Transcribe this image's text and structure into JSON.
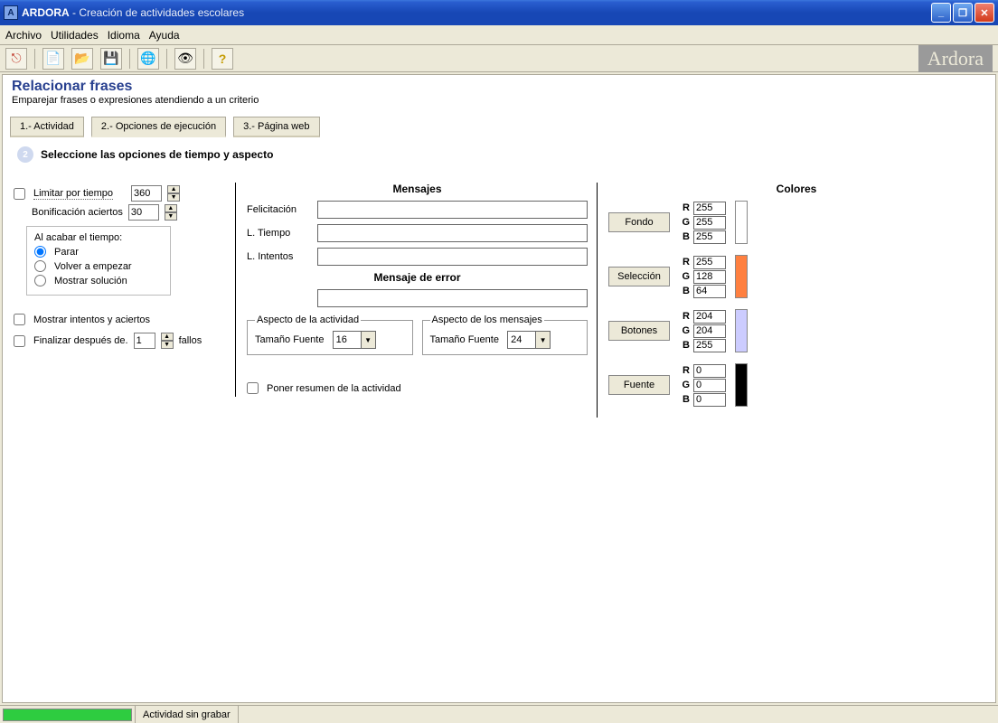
{
  "window": {
    "appname": "ARDORA",
    "subtitle": "Creación de actividades escolares"
  },
  "menus": [
    "Archivo",
    "Utilidades",
    "Idioma",
    "Ayuda"
  ],
  "brand": "Ardora",
  "header": {
    "title": "Relacionar frases",
    "desc": "Emparejar frases o expresiones atendiendo a un criterio"
  },
  "tabs": [
    {
      "label": "1.- Actividad"
    },
    {
      "label": "2.- Opciones de ejecución"
    },
    {
      "label": "3.- Página web"
    }
  ],
  "section_num": "2",
  "section_title": "Seleccione las opciones de tiempo y aspecto",
  "left": {
    "limit_time_label": "Limitar por tiempo",
    "limit_time_value": "360",
    "bonus_label": "Bonificación aciertos",
    "bonus_value": "30",
    "on_end_label": "Al acabar el tiempo:",
    "on_end_options": [
      "Parar",
      "Volver a empezar",
      "Mostrar solución"
    ],
    "show_attempts_label": "Mostrar intentos y aciertos",
    "finish_after_label": "Finalizar después de.",
    "finish_after_value": "1",
    "fails_label": "fallos"
  },
  "mid": {
    "heading": "Mensajes",
    "labels": {
      "felic": "Felicitación",
      "ltiempo": "L. Tiempo",
      "lintentos": "L. Intentos"
    },
    "error_heading": "Mensaje de error",
    "aspect_activity_legend": "Aspecto de la actividad",
    "aspect_messages_legend": "Aspecto de los mensajes",
    "font_label": "Tamaño Fuente",
    "font_activity": "16",
    "font_messages": "24",
    "summary_label": "Poner resumen de la actividad"
  },
  "right": {
    "heading": "Colores",
    "rows": [
      {
        "name": "Fondo",
        "r": "255",
        "g": "255",
        "b": "255",
        "hex": "#ffffff"
      },
      {
        "name": "Selección",
        "r": "255",
        "g": "128",
        "b": "64",
        "hex": "#ff8040"
      },
      {
        "name": "Botones",
        "r": "204",
        "g": "204",
        "b": "255",
        "hex": "#ccccff"
      },
      {
        "name": "Fuente",
        "r": "0",
        "g": "0",
        "b": "0",
        "hex": "#000000"
      }
    ],
    "rgb_labels": {
      "r": "R",
      "g": "G",
      "b": "B"
    }
  },
  "status": {
    "text": "Actividad sin grabar"
  }
}
